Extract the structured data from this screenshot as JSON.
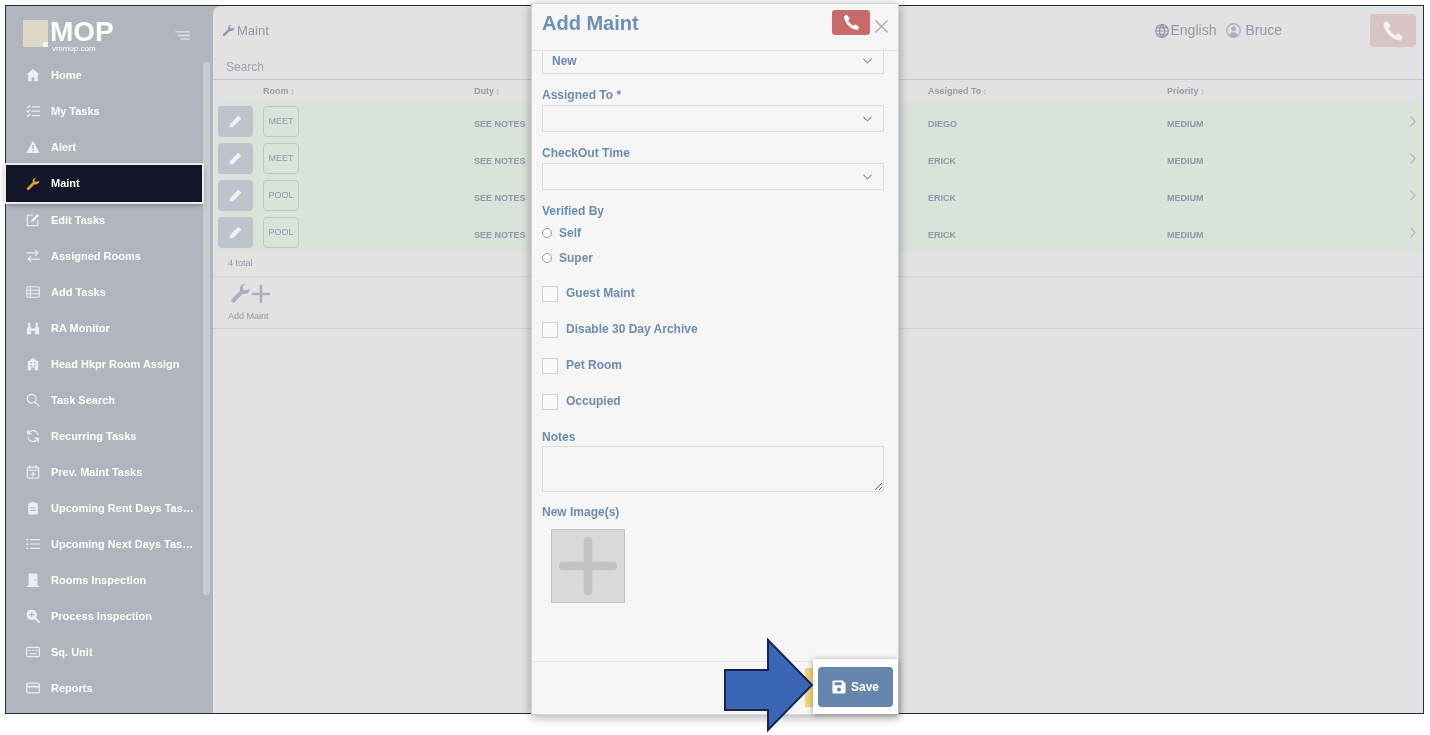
{
  "sidebar": {
    "logo": {
      "title": "MOP",
      "subtitle": "vmmop.com"
    },
    "items": [
      {
        "label": "Home",
        "selected": false
      },
      {
        "label": "My Tasks",
        "selected": false
      },
      {
        "label": "Alert",
        "selected": false
      },
      {
        "label": "Maint",
        "selected": true
      },
      {
        "label": "Edit Tasks",
        "selected": false
      },
      {
        "label": "Assigned Rooms",
        "selected": false
      },
      {
        "label": "Add Tasks",
        "selected": false
      },
      {
        "label": "RA Monitor",
        "selected": false
      },
      {
        "label": "Head Hkpr Room Assign",
        "selected": false
      },
      {
        "label": "Task Search",
        "selected": false
      },
      {
        "label": "Recurring Tasks",
        "selected": false
      },
      {
        "label": "Prev. Maint Tasks",
        "selected": false
      },
      {
        "label": "Upcoming Rent Days Tas…",
        "selected": false
      },
      {
        "label": "Upcoming Next Days Tas…",
        "selected": false
      },
      {
        "label": "Rooms Inspection",
        "selected": false
      },
      {
        "label": "Process Inspection",
        "selected": false
      },
      {
        "label": "Sq. Unit",
        "selected": false
      },
      {
        "label": "Reports",
        "selected": false
      }
    ]
  },
  "header": {
    "title": "Maint",
    "language": "English",
    "user": "Bruce"
  },
  "search": {
    "placeholder": "Search"
  },
  "table": {
    "columns": [
      "Room",
      "Duty",
      "Assigned To",
      "Priority"
    ],
    "rows": [
      {
        "room": "MEET",
        "duty": "SEE NOTES",
        "assigned_to": "DIEGO",
        "priority": "MEDIUM"
      },
      {
        "room": "MEET",
        "duty": "SEE NOTES",
        "assigned_to": "ERICK",
        "priority": "MEDIUM"
      },
      {
        "room": "POOL",
        "duty": "SEE NOTES",
        "assigned_to": "ERICK",
        "priority": "MEDIUM"
      },
      {
        "room": "POOL",
        "duty": "SEE NOTES",
        "assigned_to": "ERICK",
        "priority": "MEDIUM"
      }
    ],
    "total": "4 total"
  },
  "add_button": {
    "label": "Add Maint"
  },
  "dialog": {
    "title": "Add Maint",
    "fields": [
      {
        "kind": "select",
        "value": "New"
      },
      {
        "kind": "select",
        "label": "Assigned To *"
      },
      {
        "kind": "select",
        "label": "CheckOut Time"
      },
      {
        "kind": "radio_group",
        "label": "Verified By",
        "options": [
          {
            "label": "Self",
            "selected": false
          },
          {
            "label": "Super",
            "selected": false
          }
        ]
      },
      {
        "kind": "checkbox",
        "label": "Guest Maint",
        "checked": false
      },
      {
        "kind": "checkbox",
        "label": "Disable 30 Day Archive",
        "checked": false
      },
      {
        "kind": "checkbox",
        "label": "Pet Room",
        "checked": false
      },
      {
        "kind": "checkbox",
        "label": "Occupied",
        "checked": false
      },
      {
        "kind": "textarea",
        "label": "Notes"
      },
      {
        "kind": "image_upload",
        "label": "New Image(s)"
      }
    ],
    "save_button": "Save"
  }
}
